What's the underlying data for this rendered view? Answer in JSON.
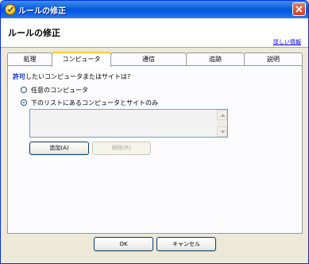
{
  "window": {
    "title": "ルールの修正"
  },
  "header": {
    "title": "ルールの修正",
    "details_link": "詳しい情報"
  },
  "tabs": [
    {
      "label": "処理",
      "active": false
    },
    {
      "label": "コンピュータ",
      "active": true
    },
    {
      "label": "通信",
      "active": false
    },
    {
      "label": "追跡",
      "active": false
    },
    {
      "label": "説明",
      "active": false
    }
  ],
  "computer_tab": {
    "question_bold": "許可",
    "question_rest": "したいコンピュータまたはサイトは?",
    "options": [
      {
        "label": "任意のコンピュータ",
        "selected": false
      },
      {
        "label": "下のリストにあるコンピュータとサイトのみ",
        "selected": true
      }
    ],
    "list_items": [],
    "add_button": "追加(A)",
    "remove_button": "削除(R)"
  },
  "footer": {
    "ok": "OK",
    "cancel": "キャンセル"
  },
  "colors": {
    "title_bar": "#0055e5",
    "accent_tab": "#ffc83c",
    "link": "#0000ee",
    "question_highlight": "#0033cc"
  }
}
